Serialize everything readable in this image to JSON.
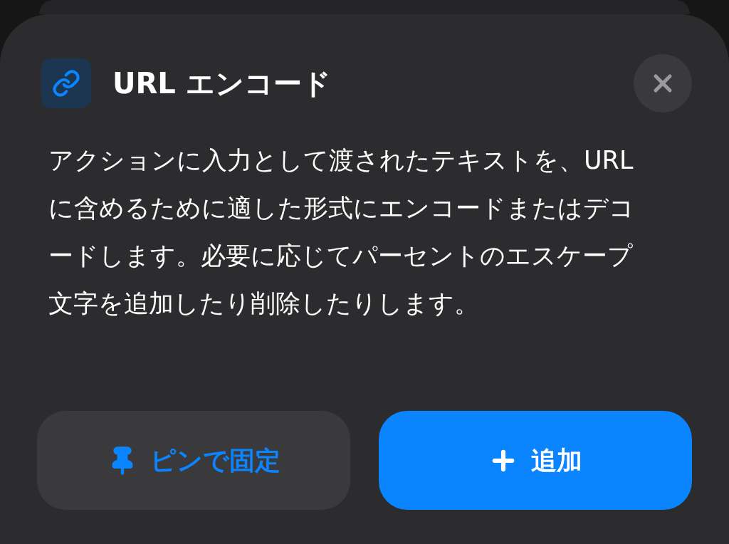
{
  "sheet": {
    "title": "URL エンコード",
    "description": "アクションに入力として渡されたテキストを、URL に含めるために適した形式にエンコードまたはデコードします。必要に応じてパーセントのエスケープ文字を追加したり削除したりします。"
  },
  "buttons": [
    {
      "label": "ピンで固定",
      "kind": "pin"
    },
    {
      "label": "追加",
      "kind": "add"
    }
  ]
}
